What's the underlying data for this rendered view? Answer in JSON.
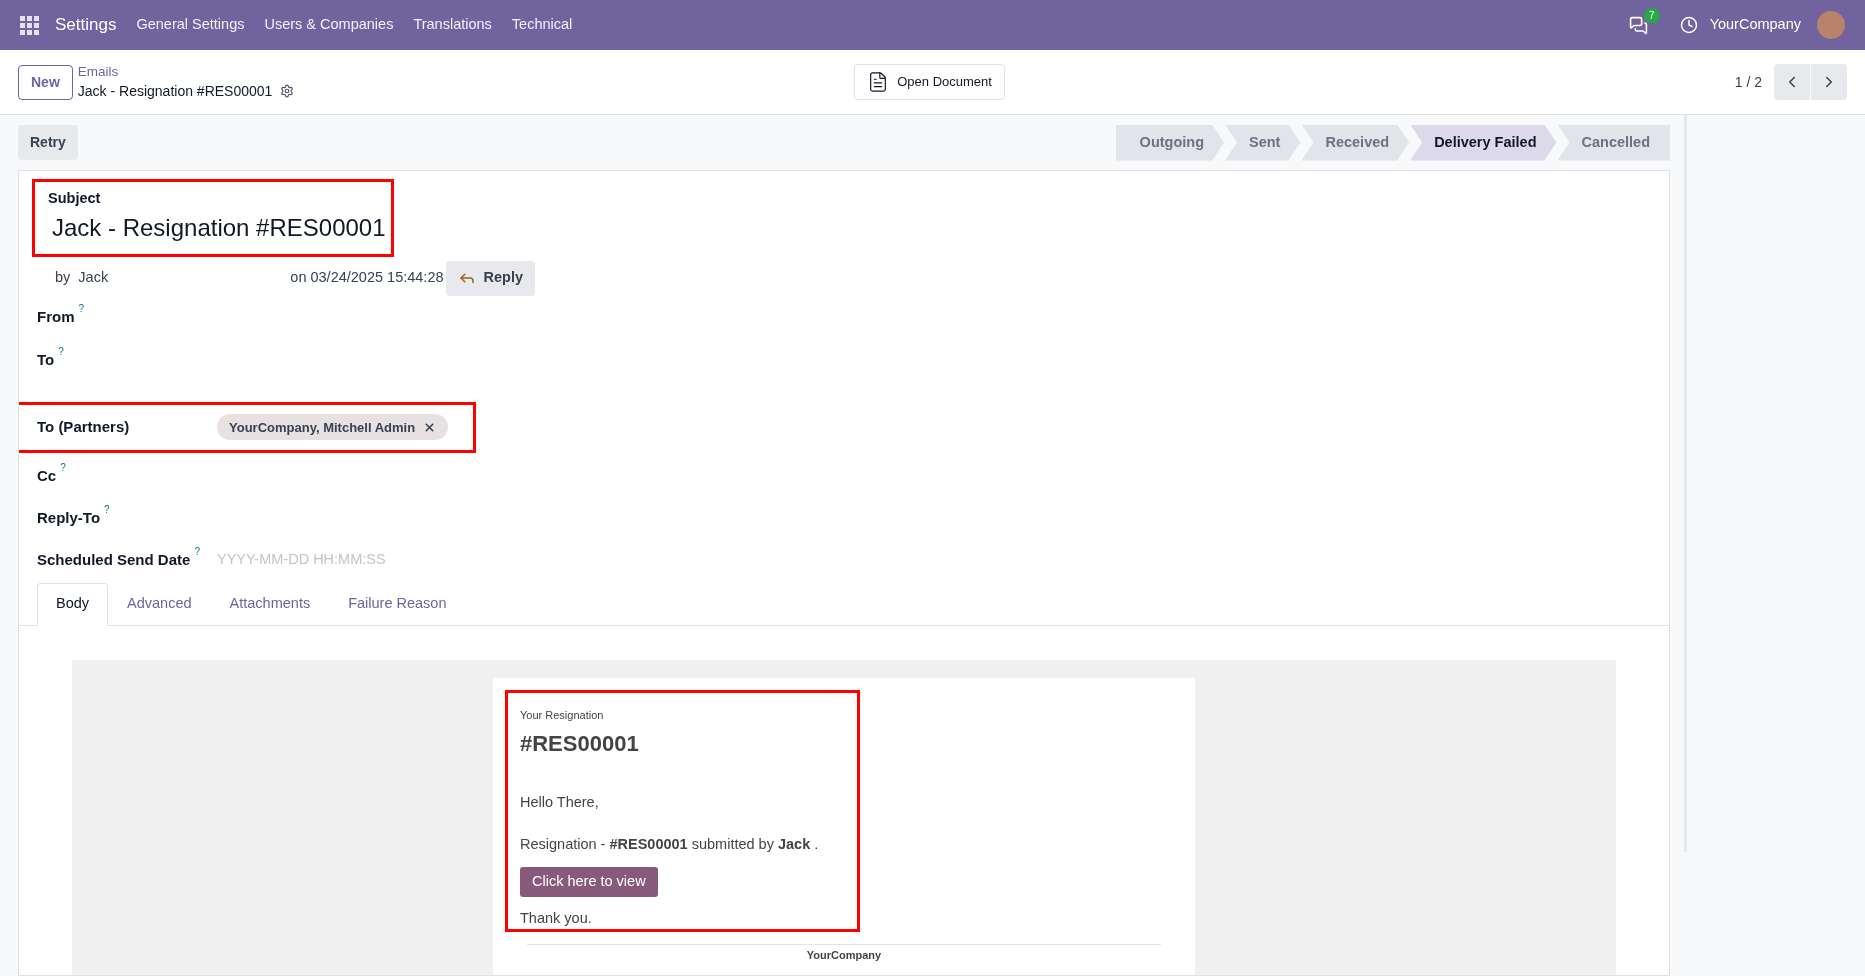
{
  "navbar": {
    "app": "Settings",
    "menus": [
      "General Settings",
      "Users & Companies",
      "Translations",
      "Technical"
    ],
    "messages_badge": "7",
    "company": "YourCompany"
  },
  "control_panel": {
    "new_button": "New",
    "breadcrumb": "Emails",
    "record": "Jack - Resignation #RES00001",
    "open_document": "Open Document",
    "pager": "1 / 2"
  },
  "actions": [
    "Retry"
  ],
  "stages": [
    {
      "label": "Outgoing",
      "selected": false
    },
    {
      "label": "Sent",
      "selected": false
    },
    {
      "label": "Received",
      "selected": false
    },
    {
      "label": "Delivery Failed",
      "selected": true
    },
    {
      "label": "Cancelled",
      "selected": false
    }
  ],
  "form": {
    "subject_label": "Subject",
    "subject": "Jack - Resignation #RES00001",
    "subject_highlighted": true,
    "author_prefix": "by",
    "author": "Jack",
    "date": "on 03/24/2025 15:44:28",
    "reply_button": "Reply",
    "fields": [
      {
        "label": "From",
        "help": "?",
        "highlighted": false
      },
      {
        "label": "To",
        "help": "?",
        "highlighted": false
      },
      {
        "label": "To (Partners)",
        "highlighted": true,
        "tags": [
          "YourCompany, Mitchell Admin"
        ]
      },
      {
        "label": "Cc",
        "help": "?",
        "highlighted": false
      },
      {
        "label": "Reply-To",
        "help": "?",
        "highlighted": false
      },
      {
        "label": "Scheduled Send Date",
        "help": "?",
        "highlighted": false,
        "placeholder": "YYYY-MM-DD HH:MM:SS"
      }
    ]
  },
  "tabs": [
    {
      "label": "Body",
      "selected": true
    },
    {
      "label": "Advanced",
      "selected": false
    },
    {
      "label": "Attachments",
      "selected": false
    },
    {
      "label": "Failure Reason",
      "selected": false
    }
  ],
  "email": {
    "highlighted": true,
    "kicker": "Your Resignation",
    "heading": "#RES00001",
    "greeting": "Hello There,",
    "message": "Resignation - **#RES00001** submitted by **Jack** .",
    "button": "Click here to view",
    "closing": "Thank you.",
    "footer": "YourCompany"
  }
}
